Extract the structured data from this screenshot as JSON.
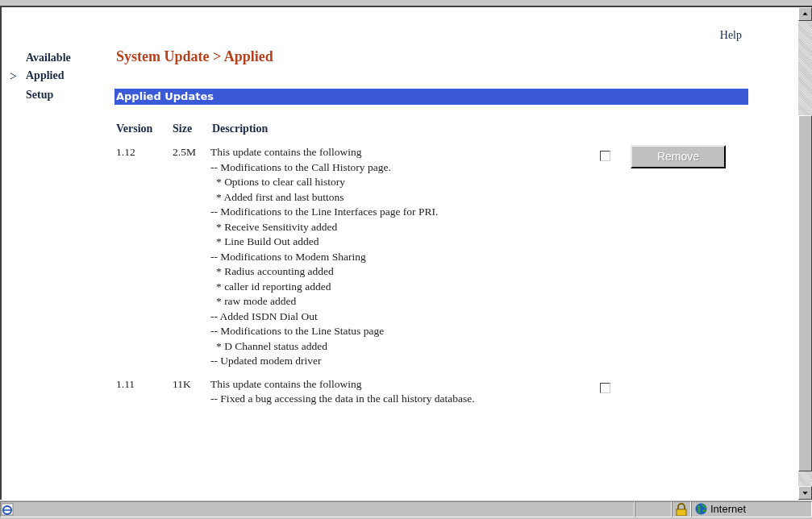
{
  "sidebar": {
    "selected_marker": ">",
    "items": [
      {
        "label": "Available",
        "selected": false
      },
      {
        "label": "Applied",
        "selected": true
      },
      {
        "label": "Setup",
        "selected": false
      }
    ]
  },
  "help_link": "Help",
  "page_title": "System Update > Applied",
  "section_title": "Applied Updates",
  "table": {
    "columns": [
      "Version",
      "Size",
      "Description"
    ],
    "rows": [
      {
        "version": "1.12",
        "size": "2.5M",
        "checked": false,
        "remove_button": {
          "label": "Remove",
          "disabled": true
        },
        "description": {
          "intro": "This update contains the following",
          "items": [
            {
              "text": "-- Modifications to the Call History page.",
              "children": [
                {
                  "text": "* Options to clear call history"
                },
                {
                  "text": "* Added first and last buttons"
                }
              ]
            },
            {
              "text": "-- Modifications to the Line Interfaces page for PRI.",
              "children": [
                {
                  "text": "* Receive Sensitivity added"
                },
                {
                  "text": "* Line Build Out added"
                }
              ]
            },
            {
              "text": "-- Modifications to Modem Sharing",
              "children": [
                {
                  "text": "* Radius accounting added"
                },
                {
                  "text": "* caller id reporting added"
                },
                {
                  "text": "* raw mode added"
                }
              ]
            },
            {
              "text": "-- Added ISDN Dial Out"
            },
            {
              "text": "-- Modifications to the Line Status page",
              "children": [
                {
                  "text": "* D Channel status added"
                }
              ]
            },
            {
              "text": "-- Updated modem driver"
            }
          ]
        }
      },
      {
        "version": "1.11",
        "size": "11K",
        "checked": false,
        "description": {
          "intro": "This update contains the following",
          "items": [
            {
              "text": "-- Fixed a bug accessing the data in the call history database."
            }
          ]
        }
      }
    ]
  },
  "status_bar": {
    "zone": "Internet"
  }
}
